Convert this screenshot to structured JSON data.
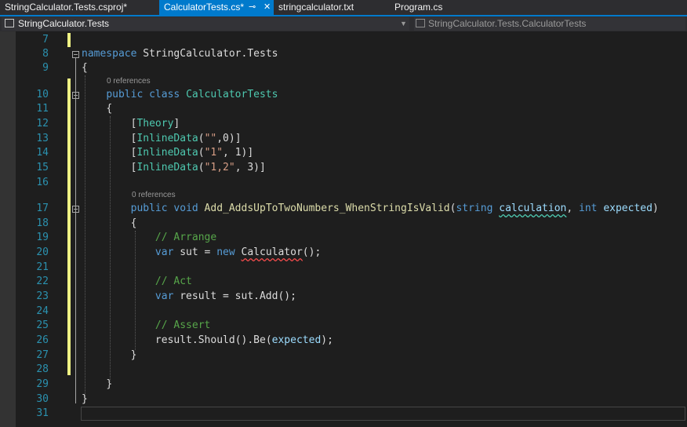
{
  "tabs": [
    {
      "label": "StringCalculator.Tests.csproj*"
    },
    {
      "label": "CalculatorTests.cs*",
      "active": true
    },
    {
      "label": "stringcalculator.txt"
    },
    {
      "label": "Program.cs"
    }
  ],
  "navbar": {
    "project": "StringCalculator.Tests",
    "type": "StringCalculator.Tests.CalculatorTests"
  },
  "line_numbers": [
    "7",
    "8",
    "9",
    "10",
    "11",
    "12",
    "13",
    "14",
    "15",
    "16",
    "17",
    "18",
    "19",
    "20",
    "21",
    "22",
    "23",
    "24",
    "25",
    "26",
    "27",
    "28",
    "29",
    "30",
    "31"
  ],
  "references": {
    "class_refs": "0 references",
    "method_refs": "0 references"
  },
  "code": {
    "l8_kw": "namespace",
    "l8_name": " StringCalculator.Tests",
    "l9": "{",
    "l10_kw": "public class",
    "l10_name": "CalculatorTests",
    "l11": "{",
    "l12_attr": "Theory",
    "l13_attr": "InlineData",
    "l13_str": "\"\"",
    "l13_rest": ",0)]",
    "l14_attr": "InlineData",
    "l14_str": "\"1\"",
    "l14_rest": ", 1)]",
    "l15_attr": "InlineData",
    "l15_str": "\"1,2\"",
    "l15_rest": ", 3)]",
    "l17_kw": "public void",
    "l17_method": "Add_AddsUpToTwoNumbers_WhenStringIsValid",
    "l17_type1": "string",
    "l17_param1": "calculation",
    "l17_type2": "int",
    "l17_param2": "expected",
    "l18": "{",
    "l19_comment": "// Arrange",
    "l20_var": "var",
    "l20_mid": " sut = ",
    "l20_new": "new",
    "l20_class": "Calculator",
    "l20_end": "();",
    "l22_comment": "// Act",
    "l23_var": "var",
    "l23_mid": " result = sut.",
    "l23_method": "Add",
    "l23_end": "();",
    "l25_comment": "// Assert",
    "l26_pre": "result.",
    "l26_m1": "Should",
    "l26_mid": "().",
    "l26_m2": "Be",
    "l26_param": "expected",
    "l26_end": ");",
    "l27": "}",
    "l29": "}",
    "l30": "}"
  },
  "colors": {
    "accent": "#007acc",
    "keyword": "#569cd6",
    "type": "#4ec9b0",
    "string": "#d69d85",
    "comment": "#57a64a",
    "line_number": "#2b91af",
    "change_marker": "#eff284"
  }
}
